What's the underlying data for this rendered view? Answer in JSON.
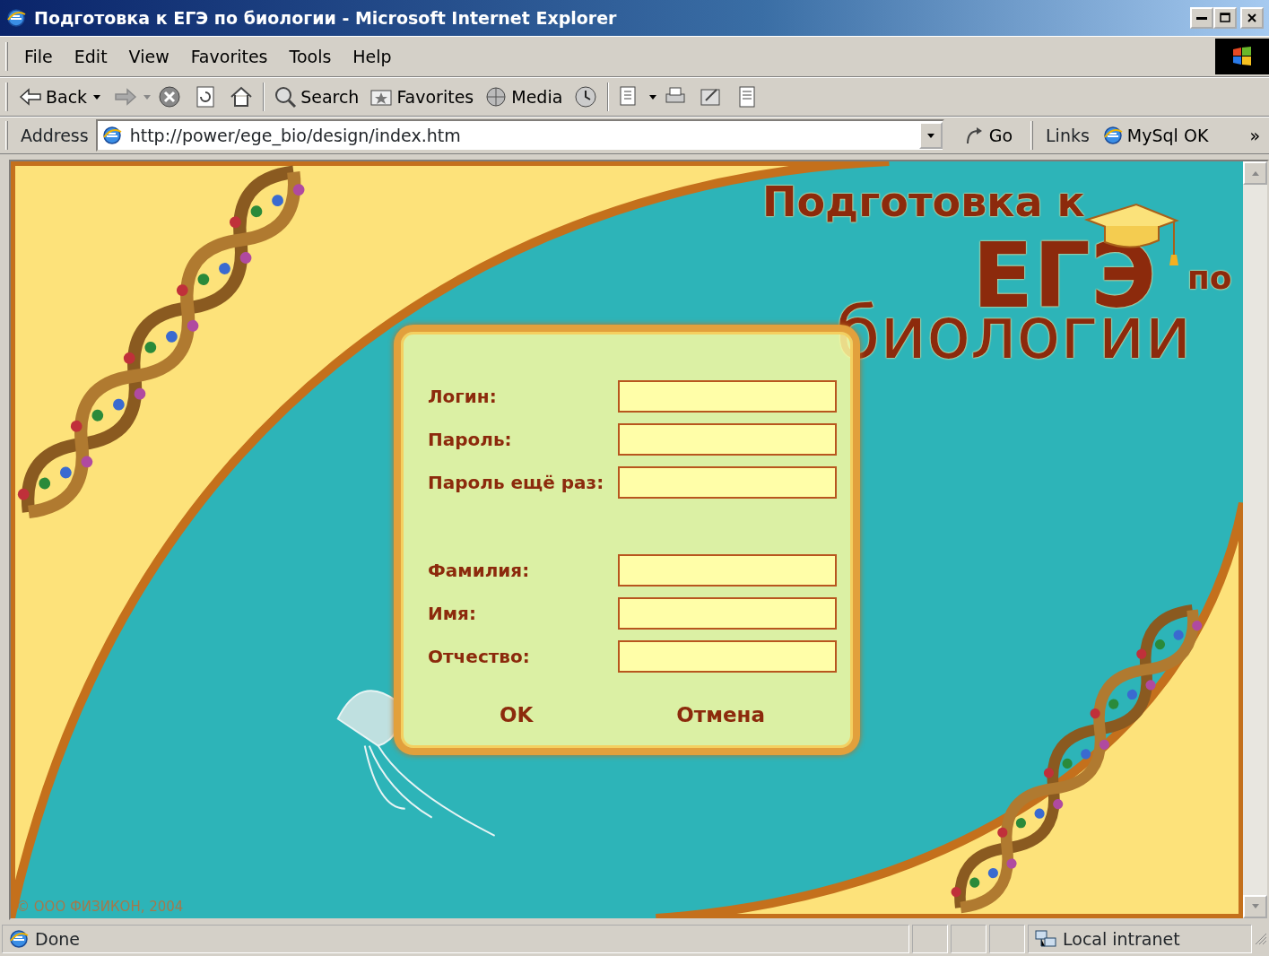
{
  "window": {
    "title": "Подготовка к ЕГЭ по биологии - Microsoft Internet Explorer"
  },
  "menu": [
    "File",
    "Edit",
    "View",
    "Favorites",
    "Tools",
    "Help"
  ],
  "toolbar": {
    "back": "Back",
    "search": "Search",
    "favorites": "Favorites",
    "media": "Media"
  },
  "address_bar": {
    "label": "Address",
    "url": "http://power/ege_bio/design/index.htm",
    "go": "Go",
    "links_label": "Links",
    "links": [
      "MySql OK"
    ],
    "more": "»"
  },
  "page": {
    "logo": {
      "line_1": "Подготовка к",
      "line_2": "ЕГЭ",
      "line_3": "по",
      "line_4": "биологии"
    },
    "account_fields": [
      {
        "label": "Логин:"
      },
      {
        "label": "Пароль:"
      },
      {
        "label": "Пароль ещё раз:"
      }
    ],
    "personal_fields": [
      {
        "label": "Фамилия:"
      },
      {
        "label": "Имя:"
      },
      {
        "label": "Отчество:"
      }
    ],
    "buttons": [
      "OK",
      "Отмена"
    ],
    "copyright": "© ООО ФИЗИКОН, 2004"
  },
  "status_bar": {
    "text": "Done",
    "zone": "Local intranet"
  }
}
